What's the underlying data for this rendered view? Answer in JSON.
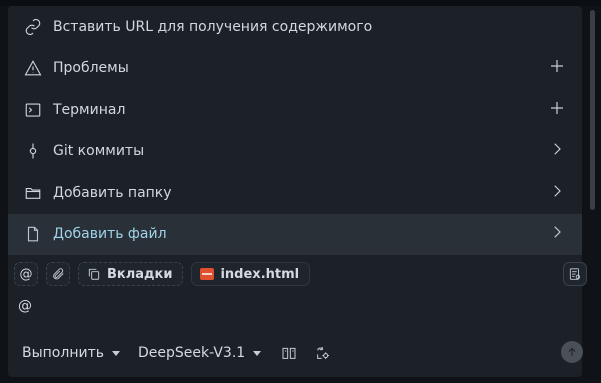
{
  "menu": {
    "items": [
      {
        "label": "Вставить URL для получения содержимого",
        "icon": "link-icon",
        "action": ""
      },
      {
        "label": "Проблемы",
        "icon": "warning-icon",
        "action": "plus-icon"
      },
      {
        "label": "Терминал",
        "icon": "terminal-icon",
        "action": "plus-icon"
      },
      {
        "label": "Git коммиты",
        "icon": "git-commit-icon",
        "action": "chevron-right-icon"
      },
      {
        "label": "Добавить папку",
        "icon": "folder-icon",
        "action": "chevron-right-icon"
      },
      {
        "label": "Добавить файл",
        "icon": "file-icon",
        "action": "chevron-right-icon"
      }
    ]
  },
  "chips": {
    "mention_symbol": "@",
    "tabs_label": "Вкладки",
    "file_label": "index.html"
  },
  "input": {
    "text": "@"
  },
  "footer": {
    "run_label": "Выполнить",
    "model_label": "DeepSeek-V3.1"
  },
  "colors": {
    "active_text": "#9fd3ea",
    "panel": "#1c2128",
    "html_badge": "#e0502f"
  }
}
